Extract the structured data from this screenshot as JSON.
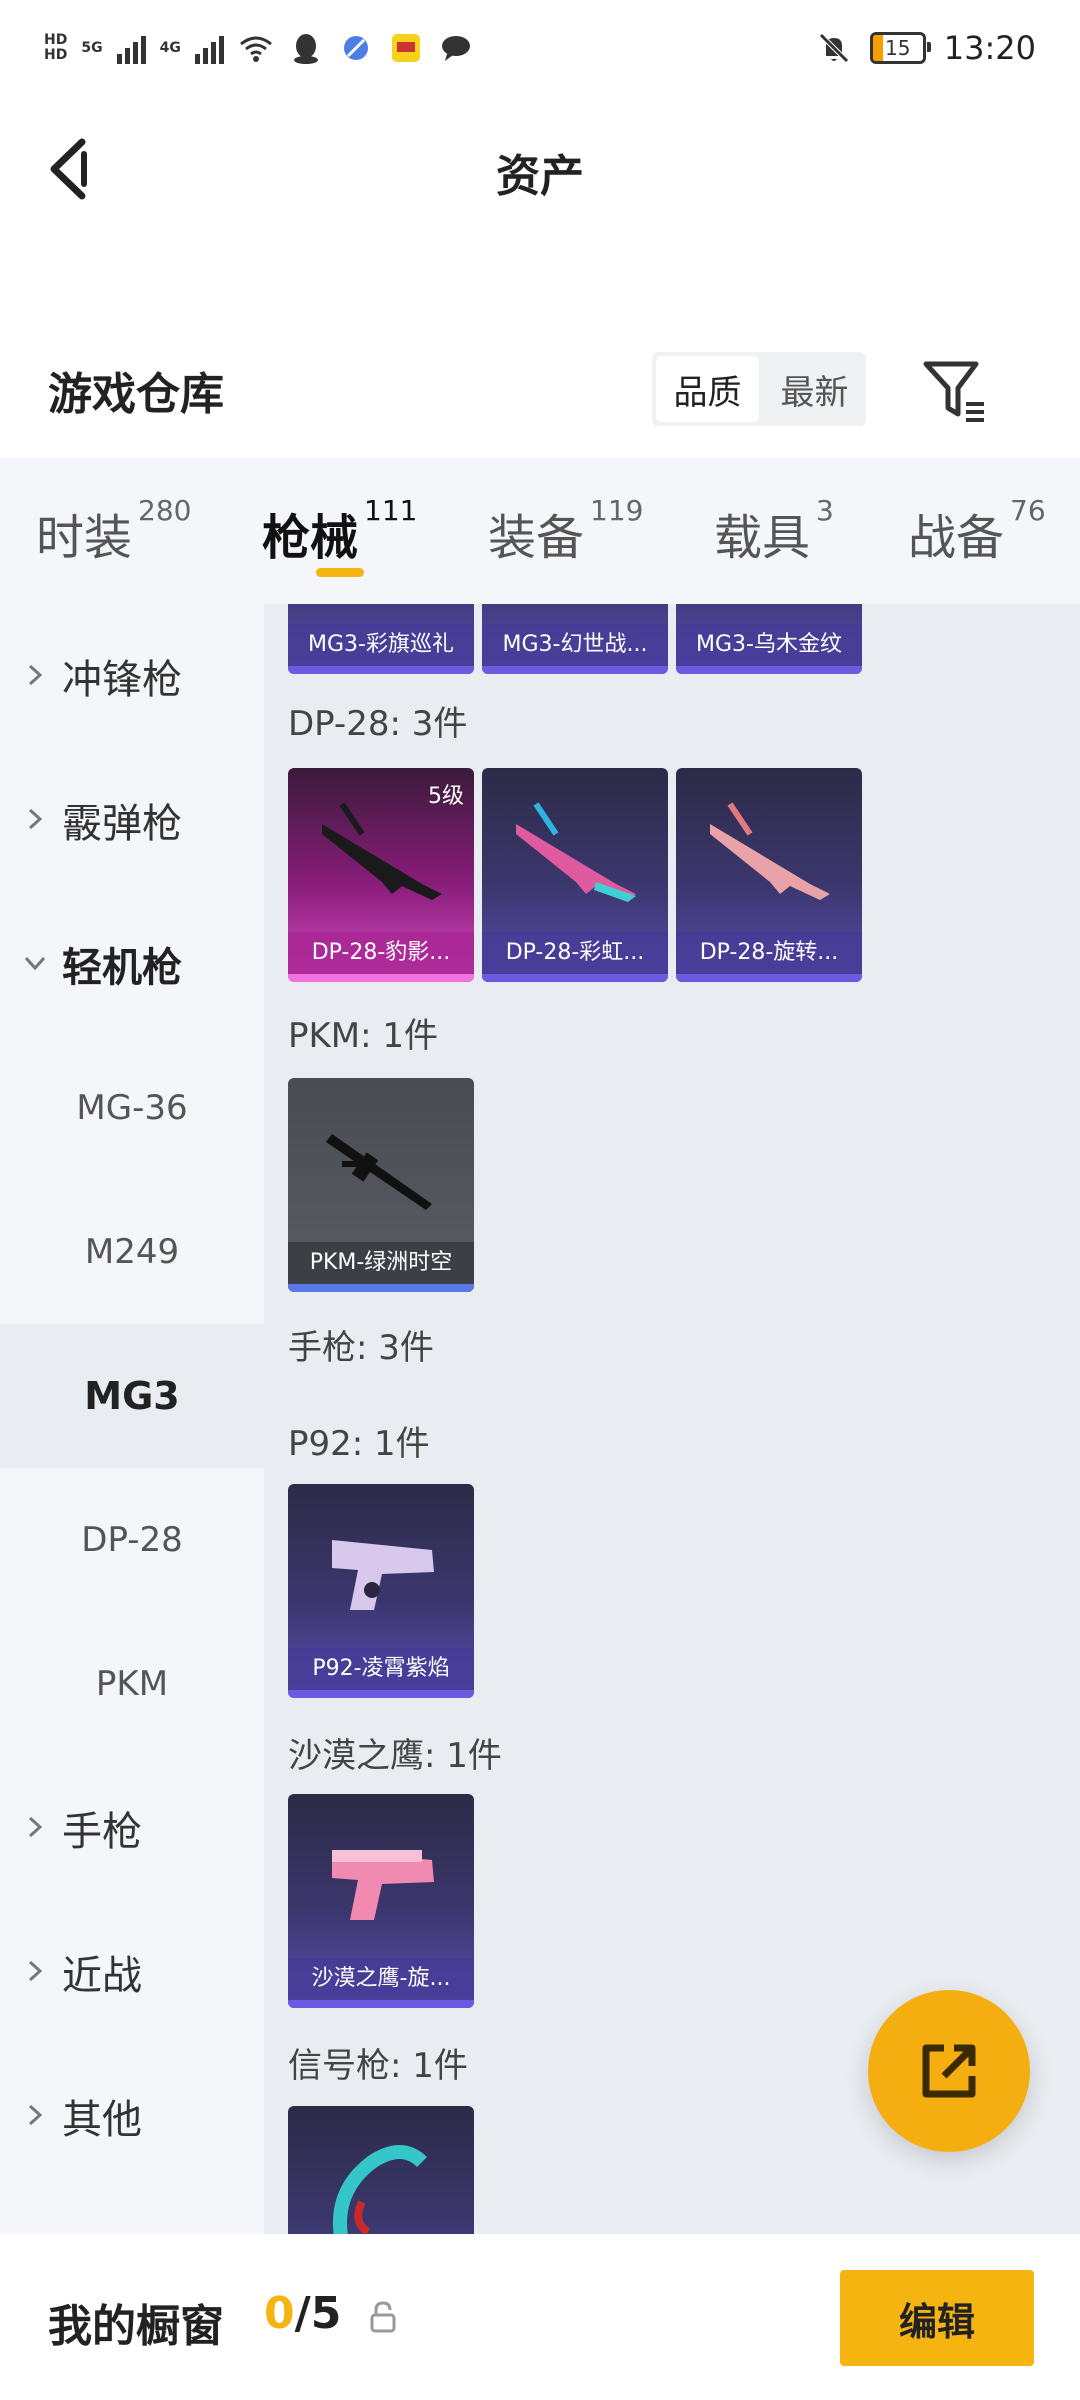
{
  "status_bar": {
    "hd1": "HD",
    "hd2": "HD",
    "net1": "5G",
    "net2": "4G",
    "battery": "15",
    "time": "13:20"
  },
  "header": {
    "title": "资产",
    "back_icon": "back-arrow-icon"
  },
  "warehouse": {
    "title": "游戏仓库",
    "sort_options": [
      "品质",
      "最新"
    ],
    "active_sort": "品质"
  },
  "tabs": [
    {
      "label": "时装",
      "count": "280"
    },
    {
      "label": "枪械",
      "count": "111"
    },
    {
      "label": "装备",
      "count": "119"
    },
    {
      "label": "载具",
      "count": "3"
    },
    {
      "label": "战备",
      "count": "76"
    }
  ],
  "active_tab": "枪械",
  "sidebar": {
    "items": [
      {
        "label": "冲锋枪"
      },
      {
        "label": "霰弹枪"
      },
      {
        "label": "轻机枪"
      },
      {
        "label": "MG-36"
      },
      {
        "label": "M249"
      },
      {
        "label": "MG3"
      },
      {
        "label": "DP-28"
      },
      {
        "label": "PKM"
      },
      {
        "label": "手枪"
      },
      {
        "label": "近战"
      },
      {
        "label": "其他"
      }
    ],
    "selected": "MG3"
  },
  "content": {
    "mg3_items": [
      "MG3-彩旗巡礼",
      "MG3-幻世战...",
      "MG3-乌木金纹"
    ],
    "dp28_header": "DP-28: 3件",
    "dp28_items": [
      "DP-28-豹影...",
      "DP-28-彩虹...",
      "DP-28-旋转..."
    ],
    "dp28_level": "5级",
    "pkm_header": "PKM: 1件",
    "pkm_items": [
      "PKM-绿洲时空"
    ],
    "pistol_header": "手枪: 3件",
    "p92_header": "P92: 1件",
    "p92_items": [
      "P92-凌霄紫焰"
    ],
    "deagle_header": "沙漠之鹰: 1件",
    "deagle_items": [
      "沙漠之鹰-旋..."
    ],
    "flare_header": "信号枪: 1件"
  },
  "bottom_bar": {
    "title": "我的橱窗",
    "count_current": "0",
    "count_total": "/5",
    "edit_label": "编辑"
  },
  "colors": {
    "accent": "#f5b40f",
    "fab": "#f5ae0f"
  }
}
